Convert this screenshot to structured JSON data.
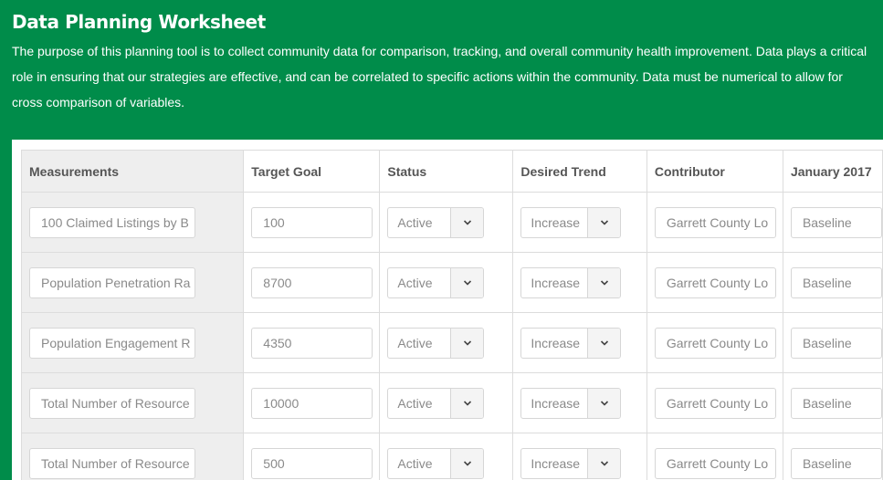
{
  "header": {
    "title": "Data Planning Worksheet",
    "description": "The purpose of this planning tool is to collect community data for comparison, tracking, and overall community health improvement. Data plays a critical role in ensuring that our strategies are effective, and can be correlated to specific actions within the community. Data must be numerical to allow for cross comparison of variables."
  },
  "table": {
    "columns": [
      "Measurements",
      "Target Goal",
      "Status",
      "Desired Trend",
      "Contributor",
      "January 2017"
    ],
    "rows": [
      {
        "measurement": "100 Claimed Listings by B",
        "target": "100",
        "status": "Active",
        "trend": "Increase",
        "contributor": "Garrett County Lo",
        "january": "Baseline"
      },
      {
        "measurement": "Population Penetration Ra",
        "target": "8700",
        "status": "Active",
        "trend": "Increase",
        "contributor": "Garrett County Lo",
        "january": "Baseline"
      },
      {
        "measurement": "Population Engagement R",
        "target": "4350",
        "status": "Active",
        "trend": "Increase",
        "contributor": "Garrett County Lo",
        "january": "Baseline"
      },
      {
        "measurement": "Total Number of Resource",
        "target": "10000",
        "status": "Active",
        "trend": "Increase",
        "contributor": "Garrett County Lo",
        "january": "Baseline"
      },
      {
        "measurement": "Total Number of Resource",
        "target": "500",
        "status": "Active",
        "trend": "Increase",
        "contributor": "Garrett County Lo",
        "january": "Baseline"
      }
    ]
  },
  "icons": {
    "dropdown": "chevron-down-icon"
  },
  "colors": {
    "brand_green": "#008c4a",
    "measurement_column_bg": "#eeeeee"
  }
}
